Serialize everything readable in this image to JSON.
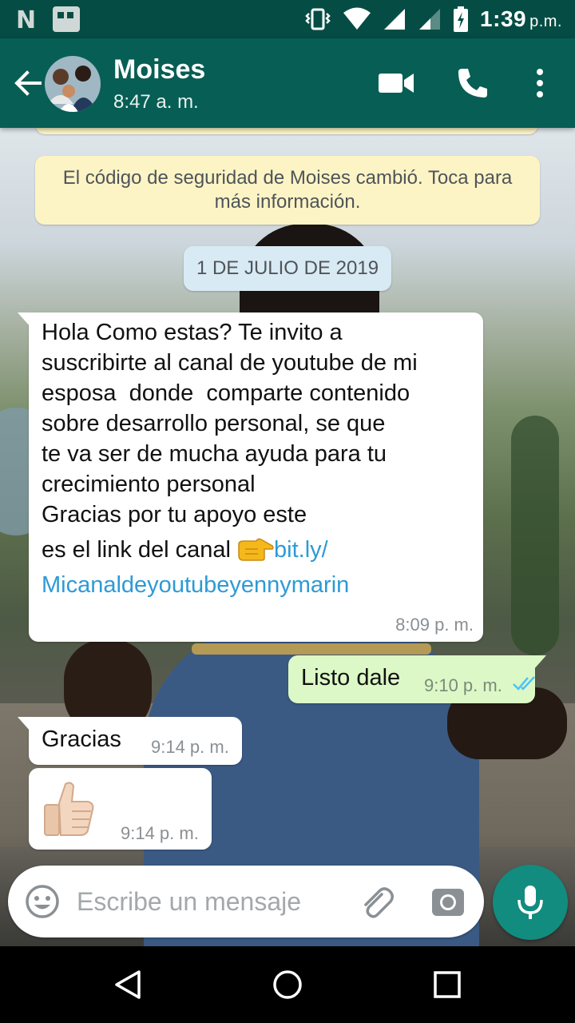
{
  "status_bar": {
    "time": "1:39",
    "time_suffix": "p.m.",
    "icons": [
      "n-notification-icon",
      "gallery-notification-icon",
      "vibrate-icon",
      "wifi-icon",
      "signal-icon",
      "signal-icon-2",
      "battery-charging-icon"
    ]
  },
  "header": {
    "contact_name": "Moises",
    "last_seen": "8:47 a. m.",
    "icons": [
      "back-arrow-icon",
      "avatar",
      "video-call-icon",
      "phone-icon",
      "more-vert-icon"
    ],
    "colors": {
      "app_bar": "#075e54",
      "status_bar": "#054d44"
    }
  },
  "chat": {
    "security_notice": "El código de seguridad de Moises cambió. Toca para más información.",
    "date_chip": "1 DE JULIO DE 2019",
    "messages": [
      {
        "direction": "in",
        "lines": [
          "Hola Como estas? Te invito a",
          "suscribirte al canal de youtube de mi",
          "esposa  donde  comparte contenido",
          "sobre desarrollo personal, se que",
          "te va ser de mucha ayuda para tu",
          "crecimiento personal",
          "Gracias por tu apoyo este"
        ],
        "link_prefix": "es el link del canal ",
        "emoji": "pointing-right-emoji",
        "link_part1": "bit.ly/",
        "link_part2": "Micanaldeyoutubeyennymarin",
        "time": "8:09 p. m."
      },
      {
        "direction": "out",
        "text": "Listo dale",
        "time": "9:10 p. m.",
        "status": "read-double-check-icon"
      },
      {
        "direction": "in",
        "text": "Gracias",
        "time": "9:14 p. m."
      },
      {
        "direction": "in",
        "emoji": "thumbs-up-emoji",
        "time": "9:14 p. m."
      }
    ],
    "colors": {
      "incoming": "#ffffff",
      "outgoing": "#dcf8c6",
      "notice": "#fdf4c5",
      "date_chip": "#d8eaf3",
      "link": "#2e9ad6",
      "read_ticks": "#4fc3f7"
    }
  },
  "composer": {
    "placeholder": "Escribe un mensaje",
    "icons": [
      "emoji-icon",
      "attach-icon",
      "camera-icon",
      "mic-icon"
    ],
    "colors": {
      "mic_button": "#128c7e"
    }
  },
  "nav_bar": {
    "icons": [
      "nav-back-icon",
      "nav-home-icon",
      "nav-recents-icon"
    ]
  }
}
